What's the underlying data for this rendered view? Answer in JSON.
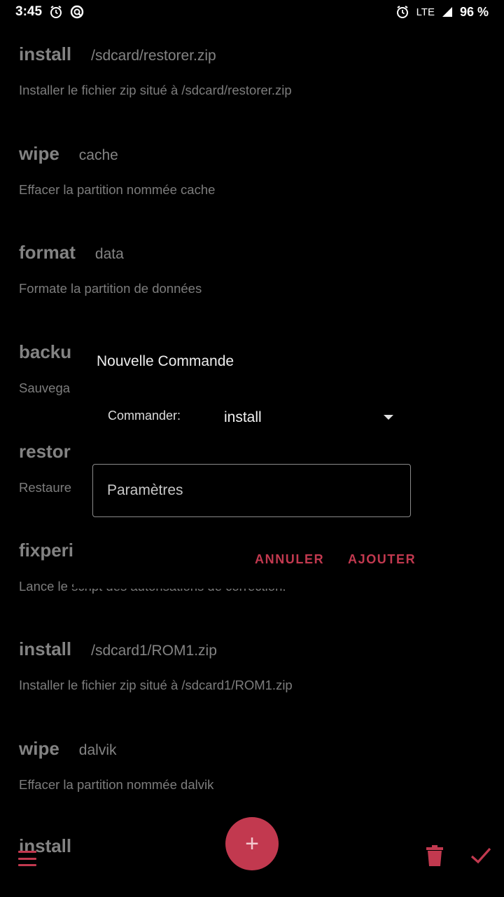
{
  "status": {
    "time": "3:45",
    "network": "LTE",
    "battery": "96 %"
  },
  "commands": [
    {
      "name": "install",
      "param": "/sdcard/restorer.zip",
      "desc": "Installer le fichier zip situé à /sdcard/restorer.zip"
    },
    {
      "name": "wipe",
      "param": "cache",
      "desc": "Effacer la partition nommée cache"
    },
    {
      "name": "format",
      "param": "data",
      "desc": "Formate la partition de données"
    },
    {
      "name": "backu",
      "param": "",
      "desc": "Sauvega"
    },
    {
      "name": "restor",
      "param": "",
      "desc": "Restaure"
    },
    {
      "name": "fixperi",
      "param": "",
      "desc": "Lance le script des autorisations de correction."
    },
    {
      "name": "install",
      "param": "/sdcard1/ROM1.zip",
      "desc": "Installer le fichier zip situé à /sdcard1/ROM1.zip"
    },
    {
      "name": "wipe",
      "param": "dalvik",
      "desc": "Effacer la partition nommée dalvik"
    },
    {
      "name": "install",
      "param": "",
      "desc": ""
    }
  ],
  "dialog": {
    "title": "Nouvelle Commande",
    "commander_label": "Commander:",
    "commander_value": "install",
    "params_placeholder": "Paramètres",
    "cancel_label": "ANNULER",
    "add_label": "AJOUTER"
  },
  "fab": {
    "label": "+"
  },
  "colors": {
    "accent": "#c2394f",
    "background": "#000000",
    "text": "#c9c9c9"
  }
}
